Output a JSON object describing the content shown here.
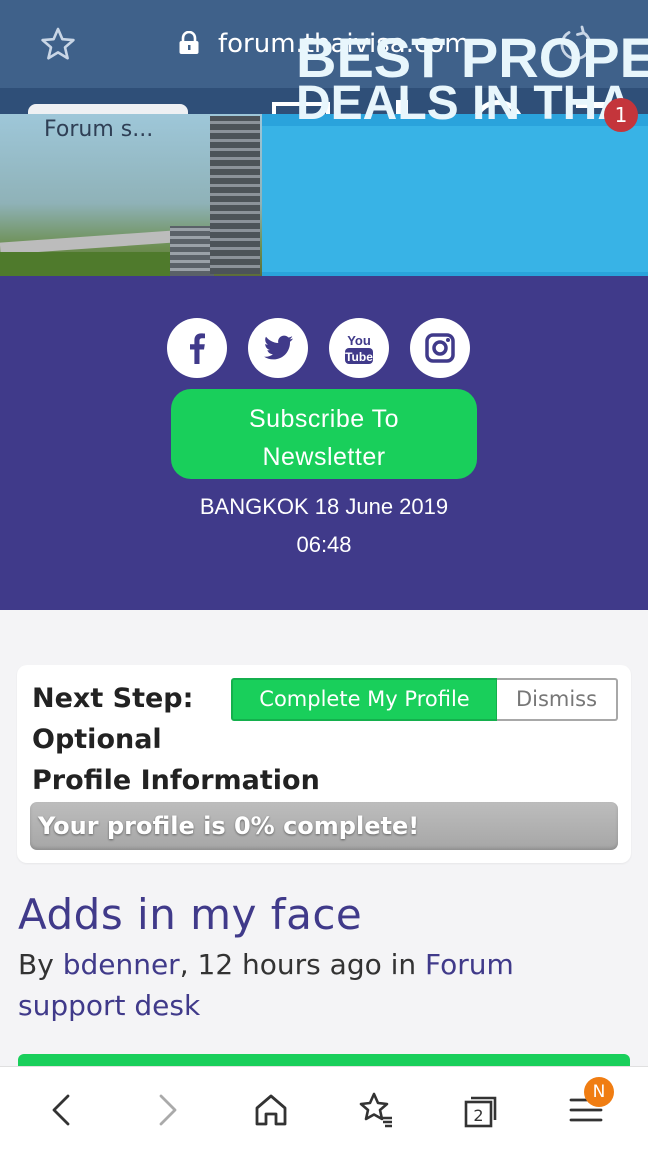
{
  "browser": {
    "url": "forum.thaivisa.com",
    "bookmark_icon": "star-outline-icon",
    "lock_icon": "lock-icon",
    "reload_icon": "reload-icon"
  },
  "site_header": {
    "forum_selector_label": "Forum s...",
    "notification_count": "1"
  },
  "ad": {
    "line1": "BEST PROPE",
    "line2": "DEALS IN THA"
  },
  "social": {
    "links": [
      {
        "name": "facebook",
        "icon": "facebook-icon"
      },
      {
        "name": "twitter",
        "icon": "twitter-icon"
      },
      {
        "name": "youtube",
        "icon": "youtube-icon"
      },
      {
        "name": "instagram",
        "icon": "instagram-icon"
      }
    ],
    "subscribe_line1": "Subscribe To",
    "subscribe_line2": "Newsletter",
    "date": "BANGKOK 18 June 2019",
    "time": "06:48"
  },
  "profile_card": {
    "title_line1": "Next Step:",
    "title_line2": "Optional",
    "title_line3": "Profile Information",
    "complete_label": "Complete My Profile",
    "dismiss_label": "Dismiss",
    "progress_text": "Your profile is 0% complete!",
    "progress_percent": 0
  },
  "topic": {
    "title": "Adds in my face",
    "by": "By ",
    "author": "bdenner",
    "time_sep": ", 12 hours ago in ",
    "forum_link": "Forum support desk"
  },
  "bottom_nav": {
    "tabs_count": "2",
    "menu_badge": "N",
    "items": [
      "back-icon",
      "forward-icon",
      "home-icon",
      "bookmarks-icon",
      "tabs-icon",
      "menu-icon"
    ]
  },
  "colors": {
    "purple": "#403a8a",
    "green": "#19cf5b",
    "address_bar": "#3f618a",
    "badge_red": "#c4353b",
    "badge_orange": "#f07d12"
  }
}
